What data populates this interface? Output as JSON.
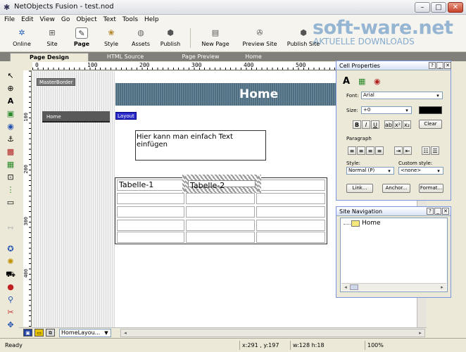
{
  "window": {
    "title": "NetObjects Fusion - test.nod",
    "min_glyph": "–",
    "max_glyph": "□",
    "close_glyph": "✕"
  },
  "menu": [
    "File",
    "Edit",
    "View",
    "Go",
    "Object",
    "Text",
    "Tools",
    "Help"
  ],
  "toolbar": {
    "online": "Online",
    "site": "Site",
    "page": "Page",
    "style": "Style",
    "assets": "Assets",
    "publish": "Publish",
    "new_page": "New Page",
    "preview_site": "Preview Site",
    "publish_site": "Publish Site"
  },
  "watermark": {
    "line1": "soft-ware.net",
    "line2": "AKTUELLE DOWNLOADS"
  },
  "view_tabs": [
    "Page Design",
    "HTML Source",
    "Page Preview",
    "Home"
  ],
  "ruler": [
    "0",
    "100",
    "200",
    "300",
    "400",
    "500"
  ],
  "vruler": [
    "100",
    "200",
    "300",
    "400"
  ],
  "canvas": {
    "masterborder_label": "MasterBorder",
    "nav_item": "Home",
    "banner": "Home",
    "layout_label": "Layout",
    "text_box": "Hier kann man einfach Text einfügen",
    "table": {
      "cell_1": "Tabelle-1",
      "cell_2": "Tabelle-2"
    }
  },
  "bottom": {
    "layout_select": "HomeLayou..."
  },
  "status": {
    "ready": "Ready",
    "coords": "x:291 , y:197",
    "size": "w:128 h:18",
    "zoom": "100%"
  },
  "cell_properties": {
    "title": "Cell Properties",
    "font_label": "Font:",
    "font_value": "Arial",
    "size_label": "Size:",
    "size_value": "+0",
    "clear": "Clear",
    "bold": "B",
    "italic": "I",
    "underline": "U",
    "paragraph_label": "Paragraph",
    "style_label": "Style:",
    "style_value": "Normal (P)",
    "custom_style_label": "Custom style:",
    "custom_style_value": "<none>",
    "link": "Link...",
    "anchor": "Anchor...",
    "format": "Format..."
  },
  "site_navigation": {
    "title": "Site Navigation",
    "node": "Home"
  },
  "colors": {
    "banner": "#5f7e8f",
    "text_color_swatch": "#000000",
    "layout_tag": "#2a2ac8"
  }
}
